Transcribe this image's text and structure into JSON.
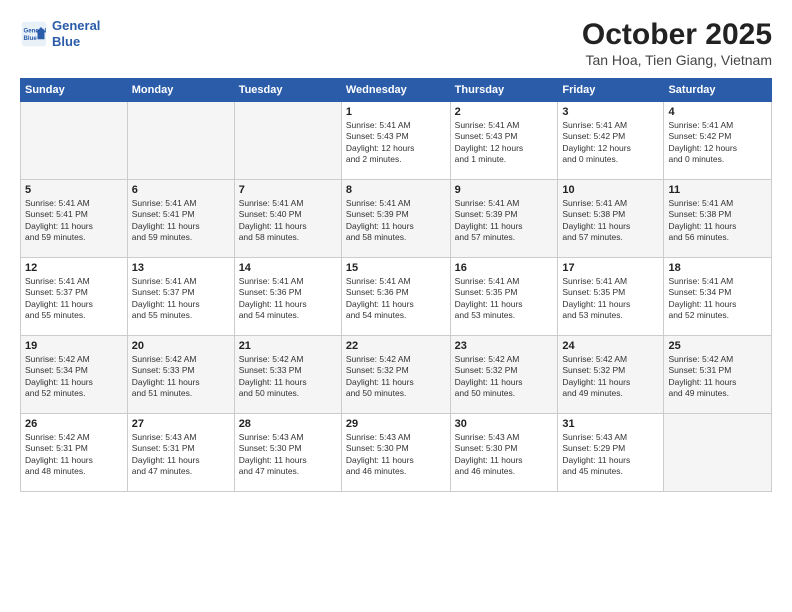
{
  "logo": {
    "line1": "General",
    "line2": "Blue"
  },
  "title": "October 2025",
  "subtitle": "Tan Hoa, Tien Giang, Vietnam",
  "days_of_week": [
    "Sunday",
    "Monday",
    "Tuesday",
    "Wednesday",
    "Thursday",
    "Friday",
    "Saturday"
  ],
  "weeks": [
    [
      {
        "num": "",
        "info": ""
      },
      {
        "num": "",
        "info": ""
      },
      {
        "num": "",
        "info": ""
      },
      {
        "num": "1",
        "info": "Sunrise: 5:41 AM\nSunset: 5:43 PM\nDaylight: 12 hours\nand 2 minutes."
      },
      {
        "num": "2",
        "info": "Sunrise: 5:41 AM\nSunset: 5:43 PM\nDaylight: 12 hours\nand 1 minute."
      },
      {
        "num": "3",
        "info": "Sunrise: 5:41 AM\nSunset: 5:42 PM\nDaylight: 12 hours\nand 0 minutes."
      },
      {
        "num": "4",
        "info": "Sunrise: 5:41 AM\nSunset: 5:42 PM\nDaylight: 12 hours\nand 0 minutes."
      }
    ],
    [
      {
        "num": "5",
        "info": "Sunrise: 5:41 AM\nSunset: 5:41 PM\nDaylight: 11 hours\nand 59 minutes."
      },
      {
        "num": "6",
        "info": "Sunrise: 5:41 AM\nSunset: 5:41 PM\nDaylight: 11 hours\nand 59 minutes."
      },
      {
        "num": "7",
        "info": "Sunrise: 5:41 AM\nSunset: 5:40 PM\nDaylight: 11 hours\nand 58 minutes."
      },
      {
        "num": "8",
        "info": "Sunrise: 5:41 AM\nSunset: 5:39 PM\nDaylight: 11 hours\nand 58 minutes."
      },
      {
        "num": "9",
        "info": "Sunrise: 5:41 AM\nSunset: 5:39 PM\nDaylight: 11 hours\nand 57 minutes."
      },
      {
        "num": "10",
        "info": "Sunrise: 5:41 AM\nSunset: 5:38 PM\nDaylight: 11 hours\nand 57 minutes."
      },
      {
        "num": "11",
        "info": "Sunrise: 5:41 AM\nSunset: 5:38 PM\nDaylight: 11 hours\nand 56 minutes."
      }
    ],
    [
      {
        "num": "12",
        "info": "Sunrise: 5:41 AM\nSunset: 5:37 PM\nDaylight: 11 hours\nand 55 minutes."
      },
      {
        "num": "13",
        "info": "Sunrise: 5:41 AM\nSunset: 5:37 PM\nDaylight: 11 hours\nand 55 minutes."
      },
      {
        "num": "14",
        "info": "Sunrise: 5:41 AM\nSunset: 5:36 PM\nDaylight: 11 hours\nand 54 minutes."
      },
      {
        "num": "15",
        "info": "Sunrise: 5:41 AM\nSunset: 5:36 PM\nDaylight: 11 hours\nand 54 minutes."
      },
      {
        "num": "16",
        "info": "Sunrise: 5:41 AM\nSunset: 5:35 PM\nDaylight: 11 hours\nand 53 minutes."
      },
      {
        "num": "17",
        "info": "Sunrise: 5:41 AM\nSunset: 5:35 PM\nDaylight: 11 hours\nand 53 minutes."
      },
      {
        "num": "18",
        "info": "Sunrise: 5:41 AM\nSunset: 5:34 PM\nDaylight: 11 hours\nand 52 minutes."
      }
    ],
    [
      {
        "num": "19",
        "info": "Sunrise: 5:42 AM\nSunset: 5:34 PM\nDaylight: 11 hours\nand 52 minutes."
      },
      {
        "num": "20",
        "info": "Sunrise: 5:42 AM\nSunset: 5:33 PM\nDaylight: 11 hours\nand 51 minutes."
      },
      {
        "num": "21",
        "info": "Sunrise: 5:42 AM\nSunset: 5:33 PM\nDaylight: 11 hours\nand 50 minutes."
      },
      {
        "num": "22",
        "info": "Sunrise: 5:42 AM\nSunset: 5:32 PM\nDaylight: 11 hours\nand 50 minutes."
      },
      {
        "num": "23",
        "info": "Sunrise: 5:42 AM\nSunset: 5:32 PM\nDaylight: 11 hours\nand 50 minutes."
      },
      {
        "num": "24",
        "info": "Sunrise: 5:42 AM\nSunset: 5:32 PM\nDaylight: 11 hours\nand 49 minutes."
      },
      {
        "num": "25",
        "info": "Sunrise: 5:42 AM\nSunset: 5:31 PM\nDaylight: 11 hours\nand 49 minutes."
      }
    ],
    [
      {
        "num": "26",
        "info": "Sunrise: 5:42 AM\nSunset: 5:31 PM\nDaylight: 11 hours\nand 48 minutes."
      },
      {
        "num": "27",
        "info": "Sunrise: 5:43 AM\nSunset: 5:31 PM\nDaylight: 11 hours\nand 47 minutes."
      },
      {
        "num": "28",
        "info": "Sunrise: 5:43 AM\nSunset: 5:30 PM\nDaylight: 11 hours\nand 47 minutes."
      },
      {
        "num": "29",
        "info": "Sunrise: 5:43 AM\nSunset: 5:30 PM\nDaylight: 11 hours\nand 46 minutes."
      },
      {
        "num": "30",
        "info": "Sunrise: 5:43 AM\nSunset: 5:30 PM\nDaylight: 11 hours\nand 46 minutes."
      },
      {
        "num": "31",
        "info": "Sunrise: 5:43 AM\nSunset: 5:29 PM\nDaylight: 11 hours\nand 45 minutes."
      },
      {
        "num": "",
        "info": ""
      }
    ]
  ]
}
